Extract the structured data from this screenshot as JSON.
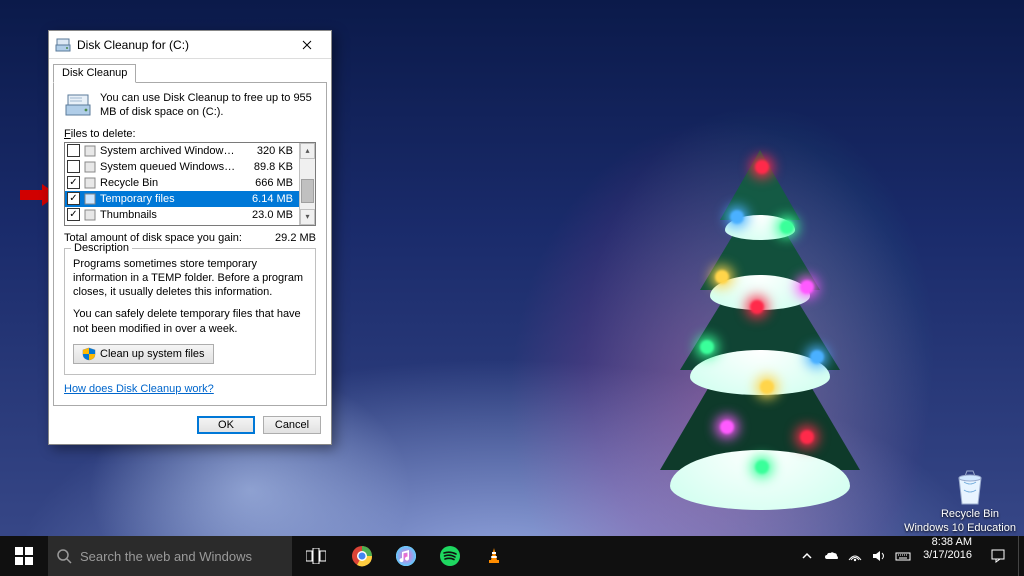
{
  "window": {
    "title": "Disk Cleanup for  (C:)",
    "tab": "Disk Cleanup",
    "intro": "You can use Disk Cleanup to free up to 955 MB of disk space on  (C:).",
    "files_to_delete_label": "Files to delete:",
    "files": [
      {
        "checked": false,
        "name": "System archived Windows Error Repor...",
        "size": "320 KB",
        "selected": false
      },
      {
        "checked": false,
        "name": "System queued Windows Error Reporti...",
        "size": "89.8 KB",
        "selected": false
      },
      {
        "checked": true,
        "name": "Recycle Bin",
        "size": "666 MB",
        "selected": false
      },
      {
        "checked": true,
        "name": "Temporary files",
        "size": "6.14 MB",
        "selected": true
      },
      {
        "checked": true,
        "name": "Thumbnails",
        "size": "23.0 MB",
        "selected": false
      }
    ],
    "total_label": "Total amount of disk space you gain:",
    "total_value": "29.2 MB",
    "description_label": "Description",
    "description_p1": "Programs sometimes store temporary information in a TEMP folder. Before a program closes, it usually deletes this information.",
    "description_p2": "You can safely delete temporary files that have not been modified in over a week.",
    "clean_system_btn": "Clean up system files",
    "help_link": "How does Disk Cleanup work?",
    "ok": "OK",
    "cancel": "Cancel"
  },
  "desktop": {
    "recycle_label": "Recycle Bin",
    "watermark_line1": "Windows 10 Education",
    "watermark_line2": ""
  },
  "taskbar": {
    "search_placeholder": "Search the web and Windows",
    "time": "8:38 AM",
    "date": "3/17/2016"
  }
}
